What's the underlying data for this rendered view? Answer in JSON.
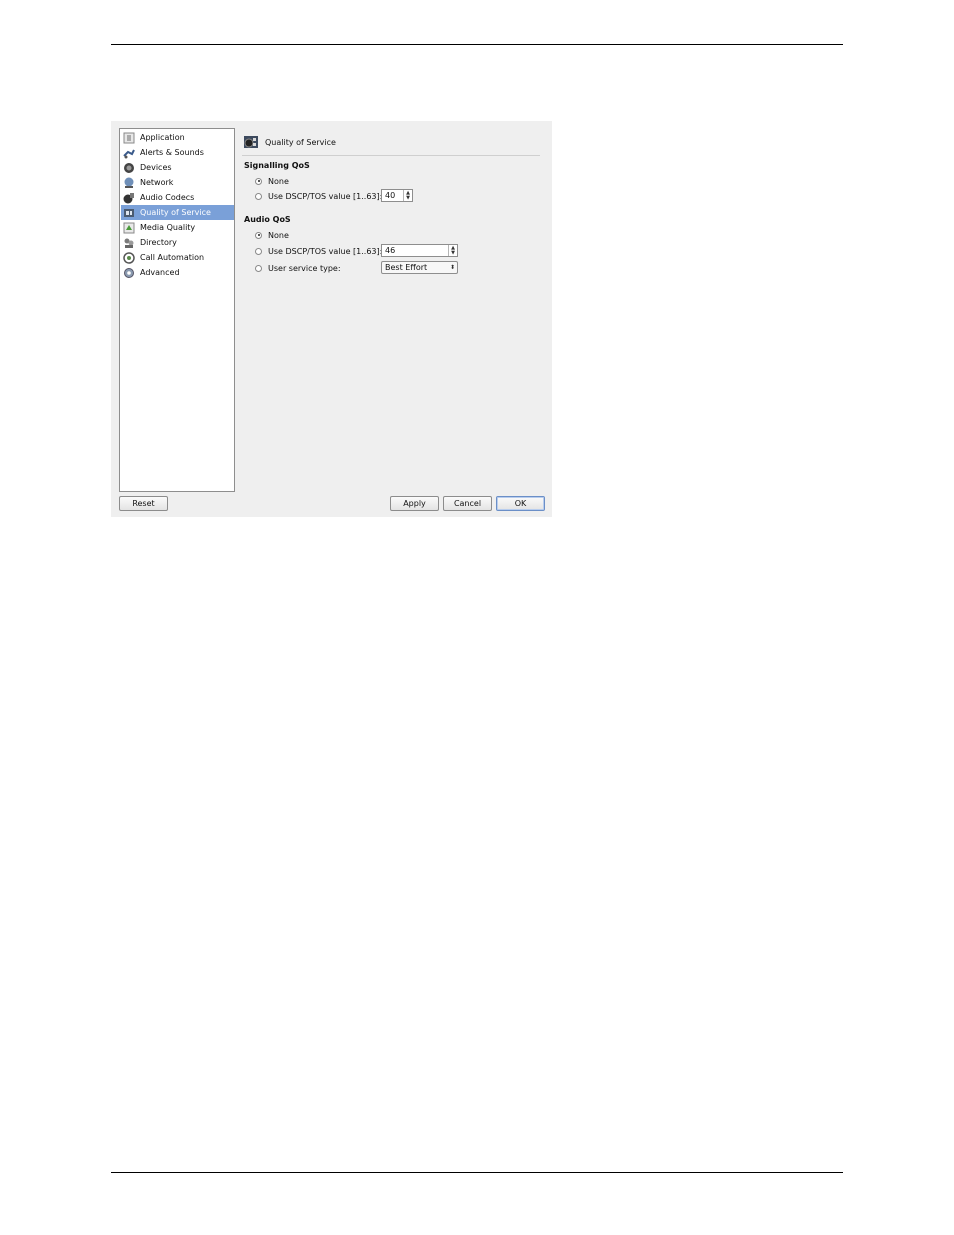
{
  "sidebar": {
    "items": [
      {
        "label": "Application",
        "icon": "application-icon"
      },
      {
        "label": "Alerts & Sounds",
        "icon": "alerts-sounds-icon"
      },
      {
        "label": "Devices",
        "icon": "headset-icon"
      },
      {
        "label": "Network",
        "icon": "network-icon"
      },
      {
        "label": "Audio Codecs",
        "icon": "audio-codecs-icon"
      },
      {
        "label": "Quality of Service",
        "icon": "quality-of-service-icon"
      },
      {
        "label": "Media Quality",
        "icon": "media-quality-icon"
      },
      {
        "label": "Directory",
        "icon": "directory-icon"
      },
      {
        "label": "Call Automation",
        "icon": "call-automation-icon"
      },
      {
        "label": "Advanced",
        "icon": "advanced-gear-icon"
      }
    ],
    "selected": "Quality of Service",
    "selected_color": "#7aa0d8"
  },
  "page": {
    "title": "Quality of Service",
    "signalling": {
      "title": "Signalling QoS",
      "none_label": "None",
      "dscp_label": "Use DSCP/TOS value [1..63]:",
      "dscp_value": "40",
      "selected": "None"
    },
    "audio": {
      "title": "Audio QoS",
      "none_label": "None",
      "dscp_label": "Use DSCP/TOS value [1..63]:",
      "dscp_value": "46",
      "service_label": "User service type:",
      "service_value": "Best Effort",
      "selected": "None"
    }
  },
  "buttons": {
    "reset": "Reset",
    "apply": "Apply",
    "cancel": "Cancel",
    "ok": "OK"
  }
}
